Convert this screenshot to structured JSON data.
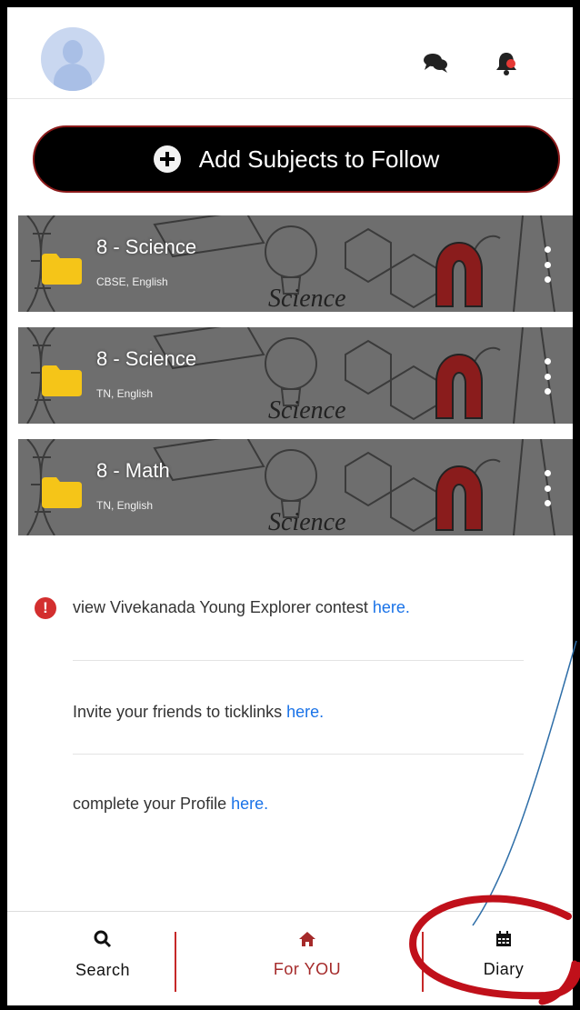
{
  "header": {
    "avatar_icon": "user-avatar-icon",
    "chat_icon": "chat-bubbles-icon",
    "bell_icon": "notification-bell-icon"
  },
  "add_button": {
    "label": "Add Subjects to Follow",
    "icon": "plus-circle-icon"
  },
  "subjects": [
    {
      "title": "8 - Science",
      "subtitle": "CBSE, English"
    },
    {
      "title": "8 - Science",
      "subtitle": "TN, English"
    },
    {
      "title": "8 - Math",
      "subtitle": "TN, English"
    }
  ],
  "notices": [
    {
      "text": "view Vivekanada Young Explorer contest ",
      "link": "here."
    },
    {
      "text": "Invite your friends to ticklinks ",
      "link": "here."
    },
    {
      "text": "complete your Profile ",
      "link": "here."
    }
  ],
  "bottom_nav": {
    "search": "Search",
    "for_you": "For YOU",
    "diary": "Diary"
  },
  "colors": {
    "accent": "#a52a2a",
    "link": "#1a73e8",
    "folder": "#f5c518"
  }
}
